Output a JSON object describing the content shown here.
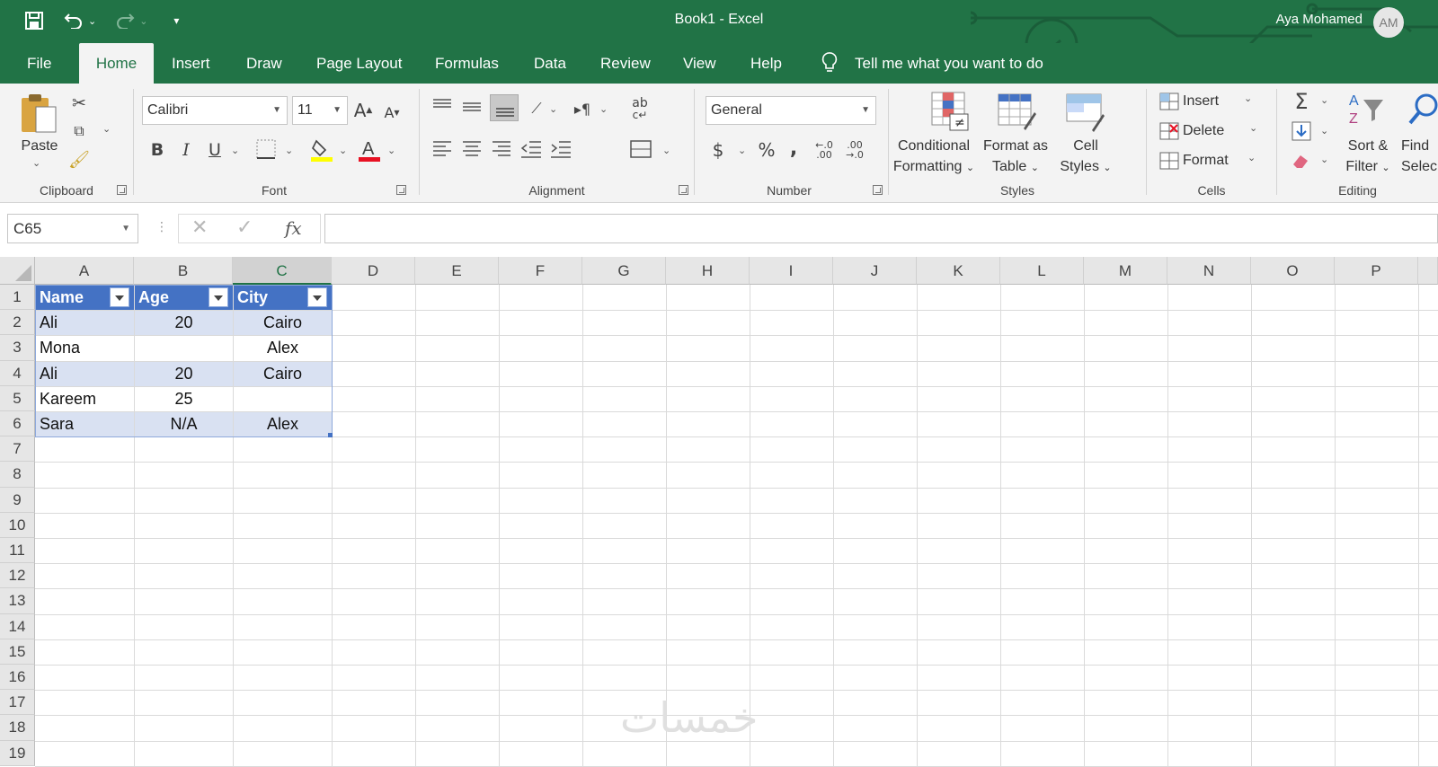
{
  "window": {
    "title": "Book1  -  Excel",
    "user_name": "Aya Mohamed",
    "user_initials": "AM"
  },
  "quick_access": {
    "save": "save-icon",
    "undo": "undo-icon",
    "redo": "redo-icon",
    "customize": "customize-icon"
  },
  "tabs": [
    {
      "label": "File"
    },
    {
      "label": "Home"
    },
    {
      "label": "Insert"
    },
    {
      "label": "Draw"
    },
    {
      "label": "Page Layout"
    },
    {
      "label": "Formulas"
    },
    {
      "label": "Data"
    },
    {
      "label": "Review"
    },
    {
      "label": "View"
    },
    {
      "label": "Help"
    }
  ],
  "active_tab": "Home",
  "tell_me": "Tell me what you want to do",
  "ribbon": {
    "clipboard": {
      "label": "Clipboard",
      "paste": "Paste"
    },
    "font": {
      "label": "Font",
      "family": "Calibri",
      "size": "11",
      "bold": "B",
      "italic": "I",
      "underline": "U",
      "font_color": "#e81123",
      "highlight_color": "#ffff00"
    },
    "alignment": {
      "label": "Alignment",
      "wrap": "ab"
    },
    "number": {
      "label": "Number",
      "format": "General",
      "currency": "$",
      "percent": "%",
      "comma": ",",
      "inc_decimal": "←.0 .00",
      "dec_decimal": ".00 →.0"
    },
    "styles": {
      "label": "Styles",
      "conditional_1": "Conditional",
      "conditional_2": "Formatting",
      "format_table_1": "Format as",
      "format_table_2": "Table",
      "cell_styles_1": "Cell",
      "cell_styles_2": "Styles"
    },
    "cells": {
      "label": "Cells",
      "insert": "Insert",
      "delete": "Delete",
      "format": "Format"
    },
    "editing": {
      "label": "Editing",
      "sort_1": "Sort &",
      "sort_2": "Filter",
      "find_1": "Find",
      "find_2": "Selec"
    }
  },
  "formula_bar": {
    "name_box": "C65",
    "fx": "fx",
    "value": ""
  },
  "columns": [
    "A",
    "B",
    "C",
    "D",
    "E",
    "F",
    "G",
    "H",
    "I",
    "J",
    "K",
    "L",
    "M",
    "N",
    "O",
    "P"
  ],
  "selected_column": "C",
  "rows": [
    "1",
    "2",
    "3",
    "4",
    "5",
    "6",
    "7",
    "8",
    "9",
    "10",
    "11",
    "12",
    "13",
    "14",
    "15",
    "16",
    "17",
    "18",
    "19"
  ],
  "table": {
    "headers": [
      "Name",
      "Age",
      "City"
    ],
    "data": [
      [
        "Ali",
        "20",
        "Cairo"
      ],
      [
        "Mona",
        "",
        "Alex"
      ],
      [
        "Ali",
        "20",
        "Cairo"
      ],
      [
        "Kareem",
        "25",
        ""
      ],
      [
        "Sara",
        "N/A",
        "Alex"
      ]
    ],
    "header_color": "#4472c4",
    "band_color": "#d9e1f2"
  },
  "watermark": "خمسات",
  "colors": {
    "excel_green": "#217346"
  }
}
